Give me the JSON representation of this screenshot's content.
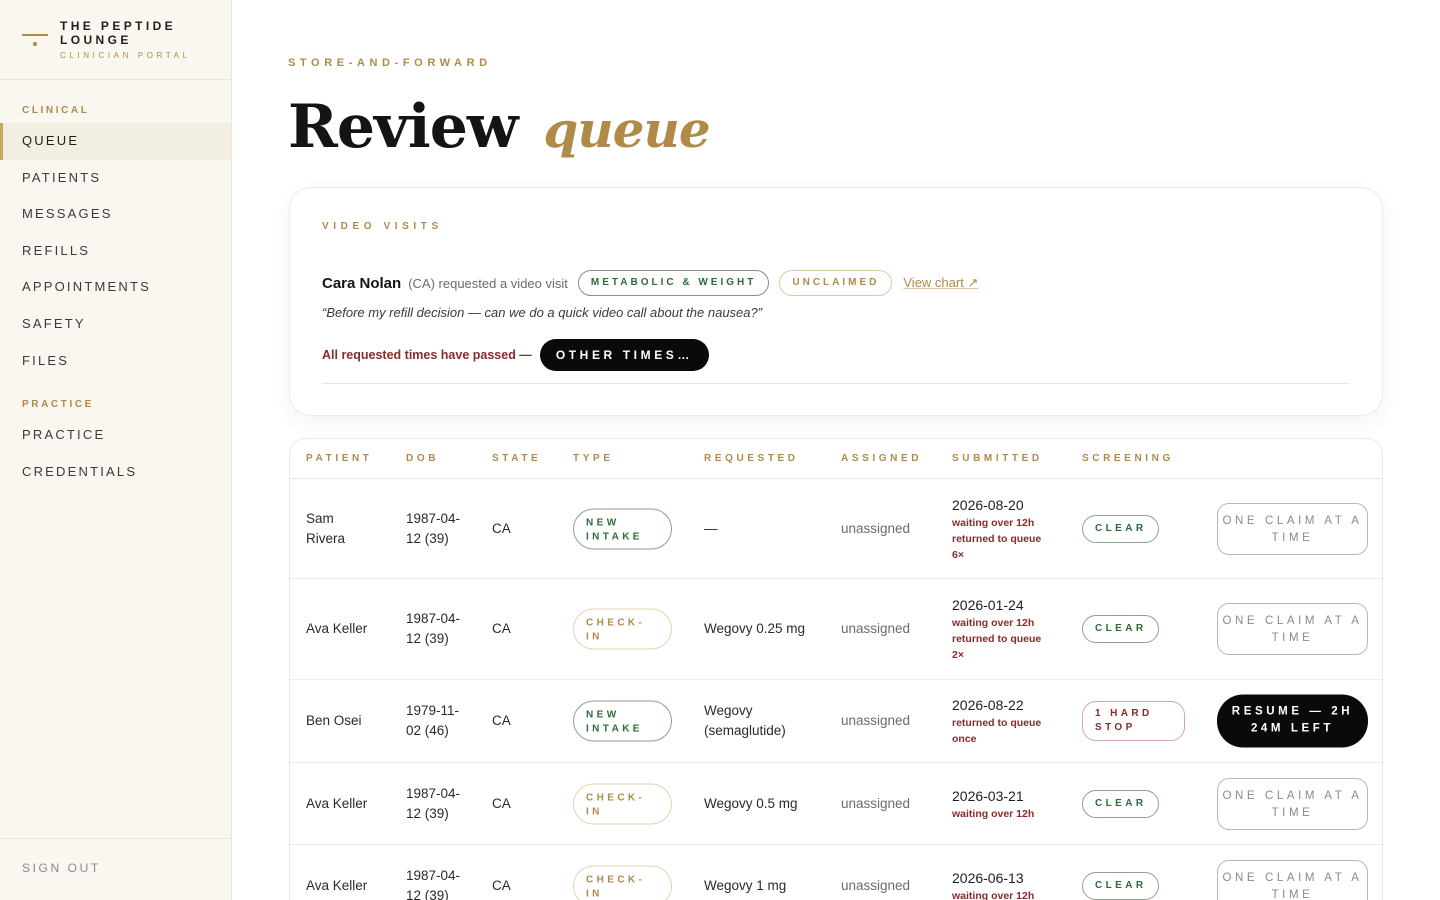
{
  "brand": {
    "name": "THE PEPTIDE LOUNGE",
    "subtitle": "CLINICIAN PORTAL"
  },
  "sidebar": {
    "sections": [
      {
        "label": "CLINICAL",
        "items": [
          {
            "label": "QUEUE",
            "active": true
          },
          {
            "label": "PATIENTS"
          },
          {
            "label": "MESSAGES"
          },
          {
            "label": "REFILLS"
          },
          {
            "label": "APPOINTMENTS"
          },
          {
            "label": "SAFETY"
          },
          {
            "label": "FILES"
          }
        ]
      },
      {
        "label": "PRACTICE",
        "items": [
          {
            "label": "PRACTICE"
          },
          {
            "label": "CREDENTIALS"
          }
        ]
      }
    ],
    "sign_out": "SIGN OUT"
  },
  "page": {
    "eyebrow": "STORE-AND-FORWARD",
    "title": "Review",
    "title_accent": "queue"
  },
  "video_visits": {
    "label": "VIDEO VISITS",
    "visit": {
      "name": "Cara Nolan",
      "meta": "(CA) requested a video visit",
      "tag": "METABOLIC & WEIGHT",
      "status": "UNCLAIMED",
      "view_chart": "View chart ↗",
      "quote": "“Before my refill decision — can we do a quick video call about the nausea?”",
      "times_note": "All requested times have passed —",
      "other_times_button": "OTHER TIMES…"
    }
  },
  "queue_table": {
    "columns": [
      "PATIENT",
      "DOB",
      "STATE",
      "TYPE",
      "REQUESTED",
      "ASSIGNED",
      "SUBMITTED",
      "SCREENING"
    ],
    "rows": [
      {
        "patient": "Sam Rivera",
        "dob": "1987-04-12 (39)",
        "state": "CA",
        "type": "NEW INTAKE",
        "requested": "—",
        "assigned": "unassigned",
        "submitted": "2026-08-20",
        "notes": [
          "waiting over 12h",
          "returned to queue 6×"
        ],
        "screening": "CLEAR",
        "action": "ONE CLAIM AT A TIME"
      },
      {
        "patient": "Ava Keller",
        "dob": "1987-04-12 (39)",
        "state": "CA",
        "type": "CHECK-IN",
        "requested": "Wegovy 0.25 mg",
        "assigned": "unassigned",
        "submitted": "2026-01-24",
        "notes": [
          "waiting over 12h",
          "returned to queue 2×"
        ],
        "screening": "CLEAR",
        "action": "ONE CLAIM AT A TIME"
      },
      {
        "patient": "Ben Osei",
        "dob": "1979-11-02 (46)",
        "state": "CA",
        "type": "NEW INTAKE",
        "requested": "Wegovy (semaglutide)",
        "assigned": "unassigned",
        "submitted": "2026-08-22",
        "notes": [
          "returned to queue once"
        ],
        "screening": "1 HARD STOP",
        "action": "RESUME — 2H 24M LEFT"
      },
      {
        "patient": "Ava Keller",
        "dob": "1987-04-12 (39)",
        "state": "CA",
        "type": "CHECK-IN",
        "requested": "Wegovy 0.5 mg",
        "assigned": "unassigned",
        "submitted": "2026-03-21",
        "notes": [
          "waiting over 12h"
        ],
        "screening": "CLEAR",
        "action": "ONE CLAIM AT A TIME"
      },
      {
        "patient": "Ava Keller",
        "dob": "1987-04-12 (39)",
        "state": "CA",
        "type": "CHECK-IN",
        "requested": "Wegovy 1 mg",
        "assigned": "unassigned",
        "submitted": "2026-06-13",
        "notes": [
          "waiting over 12h"
        ],
        "screening": "CLEAR",
        "action": "ONE CLAIM AT A TIME"
      }
    ]
  },
  "colors": {
    "gold": "#b08a48",
    "green": "#2e6b3a",
    "alert_red": "#8b2a2a",
    "black": "#0a0a0a",
    "sidebar_bg": "#faf7f0"
  }
}
